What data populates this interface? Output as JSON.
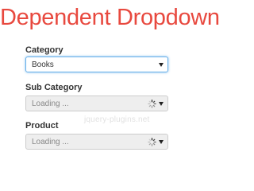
{
  "header": {
    "title": "Dependent Dropdown"
  },
  "fields": [
    {
      "label": "Category",
      "value": "Books",
      "state": "selected"
    },
    {
      "label": "Sub Category",
      "value": "Loading ...",
      "state": "loading"
    },
    {
      "label": "Product",
      "value": "Loading ...",
      "state": "loading"
    }
  ],
  "watermark": "jquery-plugins.net",
  "icons": {
    "dropdown": "chevron-down-icon",
    "loading": "spinner-icon"
  },
  "colors": {
    "title": "#e8493f",
    "focus_border": "#66afe9",
    "disabled_bg": "#eeeeee"
  }
}
